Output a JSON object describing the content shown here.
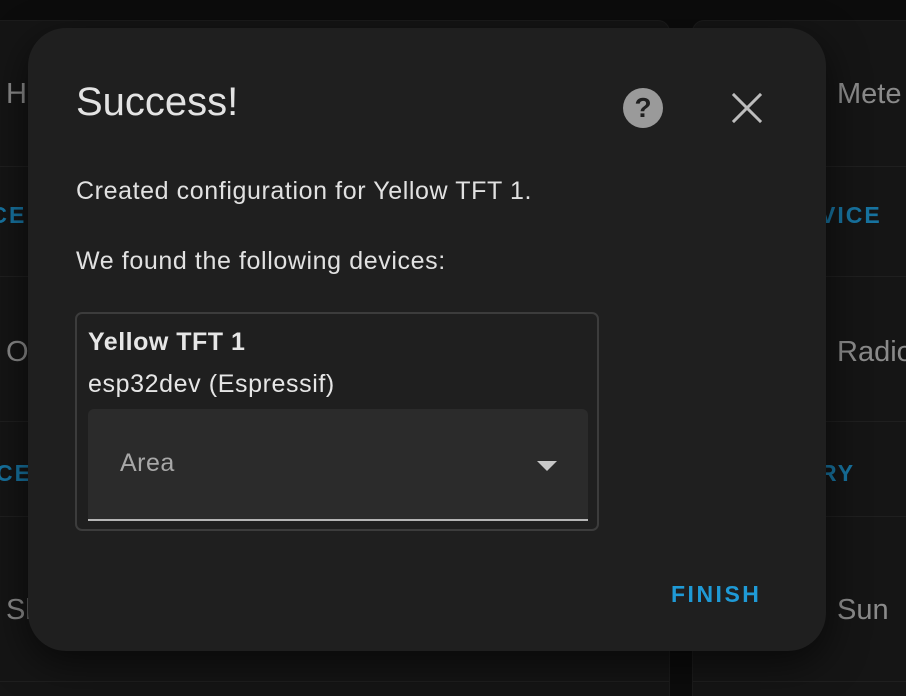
{
  "background": {
    "cards": [
      {
        "title": "H",
        "action": "ICE"
      },
      {
        "title": "Mete",
        "action": "VICE"
      },
      {
        "title": "O",
        "action": "CE"
      },
      {
        "title": "Radio",
        "action": "RY"
      },
      {
        "title": "Sh",
        "action": ""
      },
      {
        "title": "Sun",
        "action": ""
      }
    ]
  },
  "dialog": {
    "title": "Success!",
    "help_icon": "help-circle-icon",
    "close_icon": "close-icon",
    "message": "Created configuration for Yellow TFT 1.",
    "devices_heading": "We found the following devices:",
    "device": {
      "name": "Yellow TFT 1",
      "model": "esp32dev (Espressif)"
    },
    "area_select": {
      "label": "Area",
      "value": ""
    },
    "finish_label": "FINISH"
  },
  "colors": {
    "accent": "#1f9ad6",
    "dialog_bg": "#1f1f1f",
    "page_bg": "#111111"
  }
}
